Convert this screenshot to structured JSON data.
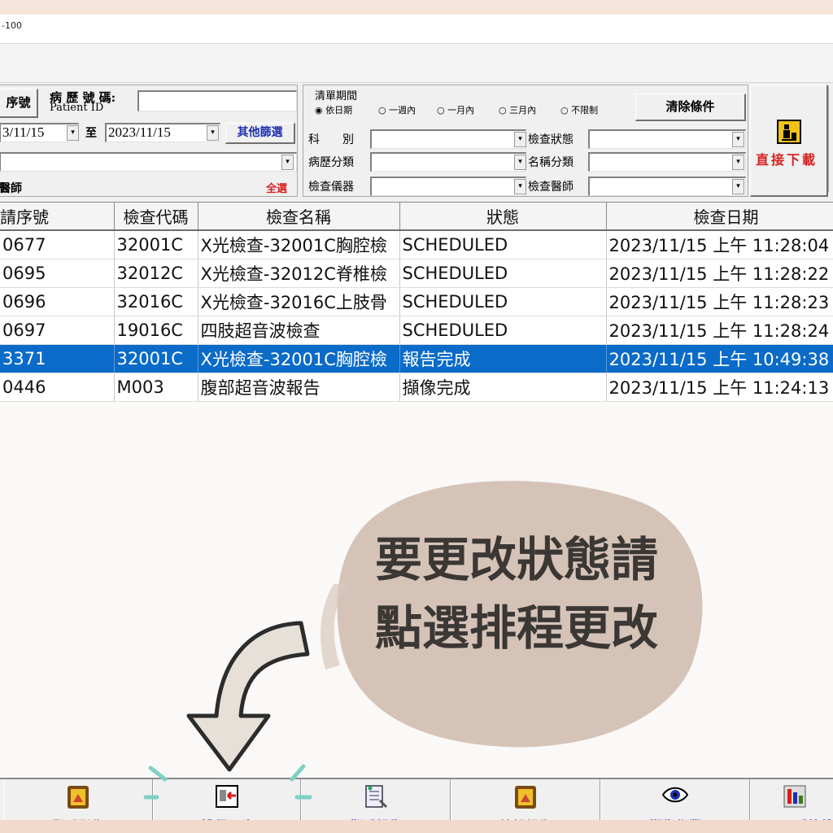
{
  "window": {
    "title": "-100"
  },
  "filter": {
    "seq_label": "序號",
    "patient_id_label": "病 歷 號 碼:",
    "patient_id_sublabel": "Patient ID",
    "patient_id_value": "",
    "date_from": "3/11/15",
    "date_to_label": "至",
    "date_to": "2023/11/15",
    "other_filter_button": "其他篩選",
    "doctor_label": "醫師",
    "select_all": "全選",
    "period_group_label": "清單期間",
    "period_options": [
      "依日期",
      "一週內",
      "一月內",
      "三月內",
      "不限制"
    ],
    "period_selected": "依日期",
    "clear_button": "清除條件",
    "dept_label": "科　　別",
    "record_class_label": "病歷分類",
    "device_label": "檢查儀器",
    "exam_status_label": "檢查狀態",
    "name_class_label": "名稱分類",
    "exam_doctor_label": "檢查醫師",
    "direct_download_label": "直接下載"
  },
  "grid": {
    "columns": [
      "請序號",
      "檢查代碼",
      "檢查名稱",
      "狀態",
      "檢查日期"
    ],
    "rows": [
      [
        "0677",
        "32001C",
        "X光檢查-32001C胸腔檢",
        "SCHEDULED",
        "2023/11/15 上午 11:28:04"
      ],
      [
        "0695",
        "32012C",
        "X光檢查-32012C脊椎檢",
        "SCHEDULED",
        "2023/11/15 上午 11:28:22"
      ],
      [
        "0696",
        "32016C",
        "X光檢查-32016C上肢骨",
        "SCHEDULED",
        "2023/11/15 上午 11:28:23"
      ],
      [
        "0697",
        "19016C",
        "四肢超音波檢查",
        "SCHEDULED",
        "2023/11/15 上午 11:28:24"
      ],
      [
        "3371",
        "32001C",
        "X光檢查-32001C胸腔檢",
        "報告完成",
        "2023/11/15 上午 10:49:38"
      ],
      [
        "0446",
        "M003",
        "腹部超音波報告",
        "擷像完成",
        "2023/11/15 上午 11:24:13"
      ]
    ],
    "selected_row": 4,
    "selection_color": "#0a6bc9"
  },
  "annotation": {
    "line1": "要更改狀態請",
    "line2": "點選排程更改",
    "blob_color": "#d6c3b8"
  },
  "toolbar": {
    "buttons": [
      {
        "label": "觀看影像",
        "icon": "image-viewer-icon"
      },
      {
        "label": "排程更改",
        "icon": "schedule-change-icon"
      },
      {
        "label": "觀看報告",
        "icon": "report-view-icon"
      },
      {
        "label": "編輯報告",
        "icon": "report-edit-icon"
      },
      {
        "label": "擷像作業",
        "icon": "eye-capture-icon"
      },
      {
        "label": "系統維",
        "icon": "system-settings-icon"
      }
    ]
  }
}
